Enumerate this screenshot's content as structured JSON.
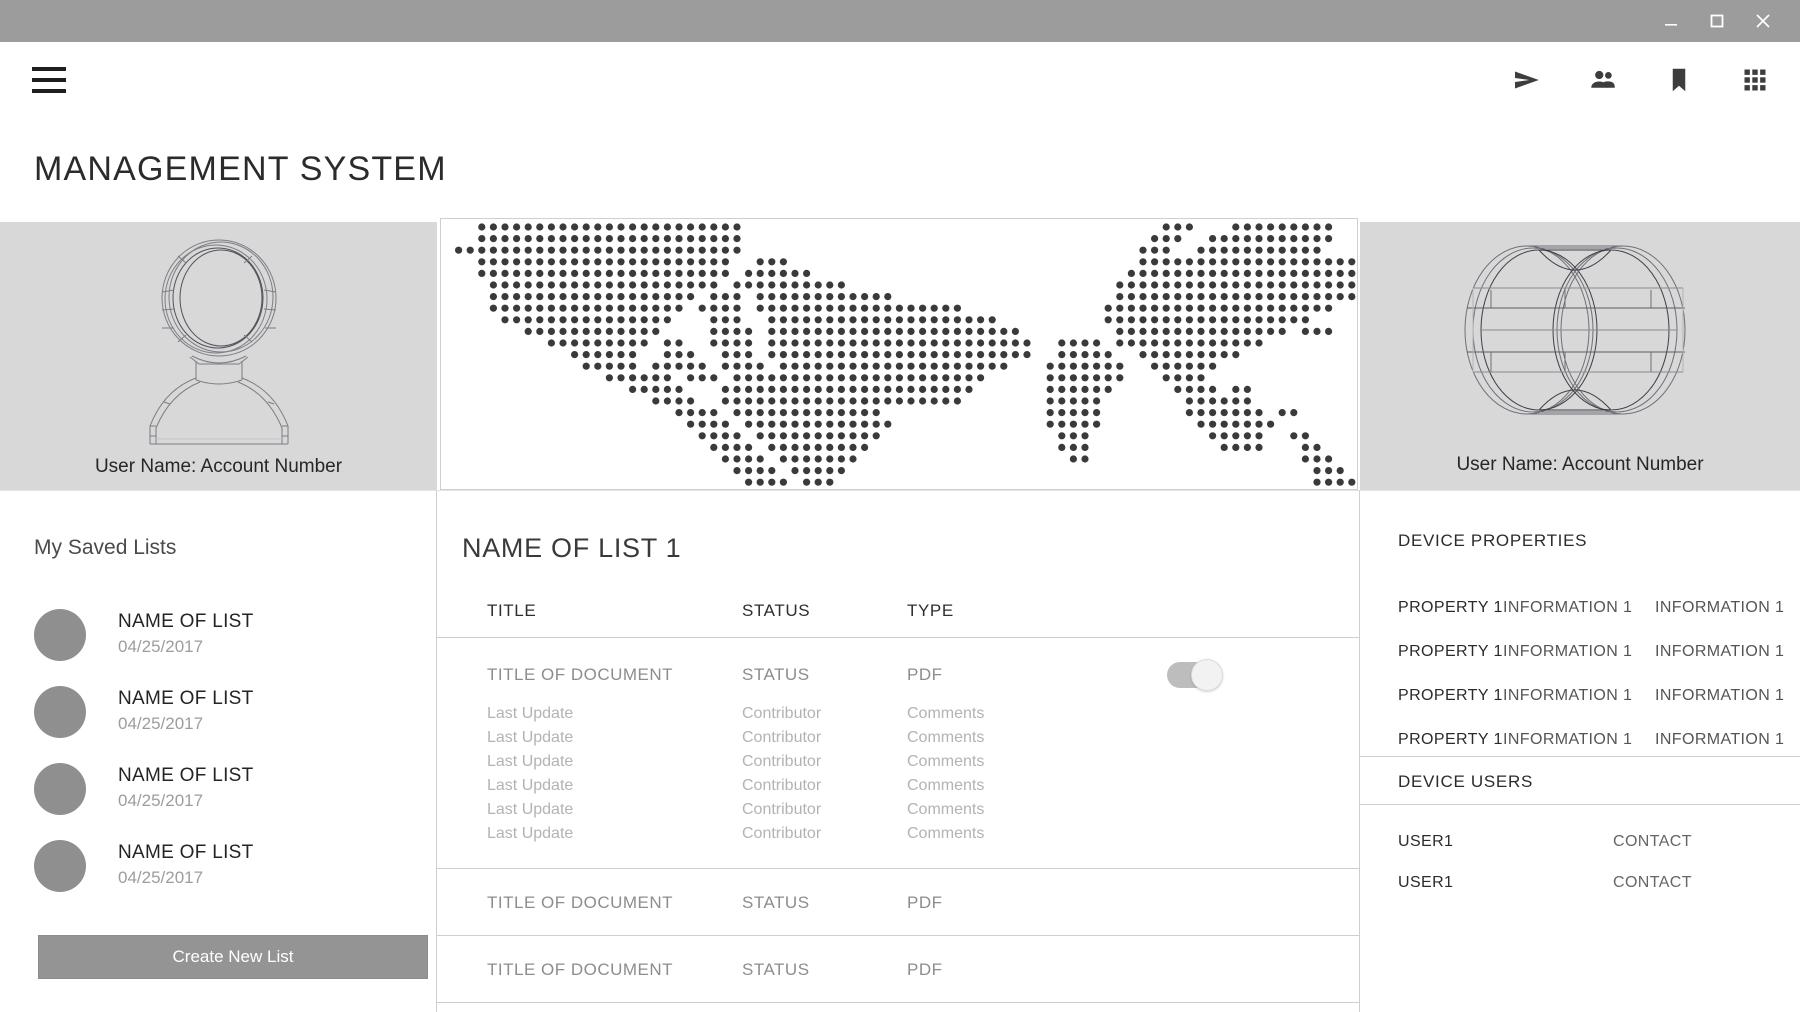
{
  "window": {
    "controls": [
      {
        "name": "minimize",
        "glyph": "minimize-icon"
      },
      {
        "name": "maximize",
        "glyph": "maximize-icon"
      },
      {
        "name": "close",
        "glyph": "close-icon"
      }
    ]
  },
  "appbar": {
    "menu_icon": "hamburger-menu-icon",
    "actions": [
      {
        "name": "send-icon",
        "label": "Send"
      },
      {
        "name": "people-icon",
        "label": "People"
      },
      {
        "name": "bookmark-icon",
        "label": "Bookmark"
      },
      {
        "name": "apps-grid-icon",
        "label": "Apps"
      }
    ]
  },
  "page": {
    "title": "MANAGEMENT SYSTEM"
  },
  "account_card": {
    "illustration": "wireframe-person-icon",
    "caption": "User Name: Account Number"
  },
  "device_card": {
    "illustration": "wireframe-cylinder-icon",
    "caption": "User Name: Account Number"
  },
  "map_card": {
    "illustration": "dotted-world-map"
  },
  "sidebar": {
    "heading": "My Saved Lists",
    "items": [
      {
        "name": "NAME OF LIST",
        "date": "04/25/2017"
      },
      {
        "name": "NAME OF LIST",
        "date": "04/25/2017"
      },
      {
        "name": "NAME OF LIST",
        "date": "04/25/2017"
      },
      {
        "name": "NAME OF LIST",
        "date": "04/25/2017"
      }
    ],
    "create_button": "Create New List"
  },
  "list_panel": {
    "title": "NAME OF LIST 1",
    "columns": {
      "title": "TITLE",
      "status": "STATUS",
      "type": "TYPE"
    },
    "rows": [
      {
        "title": "TITLE OF DOCUMENT",
        "status": "STATUS",
        "type": "PDF",
        "toggle_on": true,
        "sub_rows": [
          {
            "last_update": "Last Update",
            "contributor": "Contributor",
            "comments": "Comments"
          },
          {
            "last_update": "Last Update",
            "contributor": "Contributor",
            "comments": "Comments"
          },
          {
            "last_update": "Last Update",
            "contributor": "Contributor",
            "comments": "Comments"
          },
          {
            "last_update": "Last Update",
            "contributor": "Contributor",
            "comments": "Comments"
          },
          {
            "last_update": "Last Update",
            "contributor": "Contributor",
            "comments": "Comments"
          },
          {
            "last_update": "Last Update",
            "contributor": "Contributor",
            "comments": "Comments"
          }
        ]
      },
      {
        "title": "TITLE OF DOCUMENT",
        "status": "STATUS",
        "type": "PDF",
        "toggle_on": false,
        "sub_rows": []
      },
      {
        "title": "TITLE OF DOCUMENT",
        "status": "STATUS",
        "type": "PDF",
        "toggle_on": false,
        "sub_rows": []
      }
    ]
  },
  "properties_panel": {
    "heading": "DEVICE PROPERTIES",
    "rows": [
      {
        "property": "PROPERTY 1",
        "info1": "INFORMATION 1",
        "info2": "INFORMATION 1"
      },
      {
        "property": "PROPERTY 1",
        "info1": "INFORMATION 1",
        "info2": "INFORMATION 1"
      },
      {
        "property": "PROPERTY 1",
        "info1": "INFORMATION 1",
        "info2": "INFORMATION 1"
      },
      {
        "property": "PROPERTY 1",
        "info1": "INFORMATION 1",
        "info2": "INFORMATION 1"
      }
    ]
  },
  "users_panel": {
    "heading": "DEVICE USERS",
    "rows": [
      {
        "user": "USER1",
        "contact": "CONTACT"
      },
      {
        "user": "USER1",
        "contact": "CONTACT"
      }
    ]
  },
  "colors": {
    "titlebar": "#9c9c9c",
    "card_gray": "#d8d8d8",
    "bullet_gray": "#8f8f8f",
    "button_gray": "#949494",
    "map_dot": "#3a3a3a",
    "text_dark": "#2b2b2b",
    "text_muted": "#8d8d8d",
    "text_faint": "#b3b3b3",
    "divider": "#cfcfcf"
  }
}
